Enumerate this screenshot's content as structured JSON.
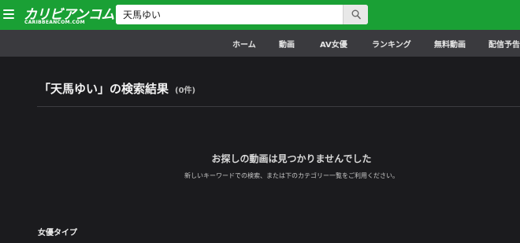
{
  "header": {
    "logo_text": "カリビアンコム",
    "logo_subtext": "CARIBBEANCOM.COM",
    "menu_icon": "hamburger-menu-icon",
    "search": {
      "value": "天馬ゆい",
      "placeholder": "",
      "button_icon": "search-icon"
    },
    "accent_color": "#1aa035"
  },
  "nav": {
    "items": [
      {
        "label": "ホーム"
      },
      {
        "label": "動画"
      },
      {
        "label": "AV女優"
      },
      {
        "label": "ランキング"
      },
      {
        "label": "無料動画"
      },
      {
        "label": "配信予告"
      }
    ]
  },
  "main": {
    "title": "「天馬ゆい」の検索結果",
    "result_count": "(0件)",
    "empty_title": "お探しの動画は見つかりませんでした",
    "empty_description": "新しいキーワードでの検索、または下のカテゴリー一覧をご利用ください。",
    "section_heading": "女優タイプ"
  }
}
